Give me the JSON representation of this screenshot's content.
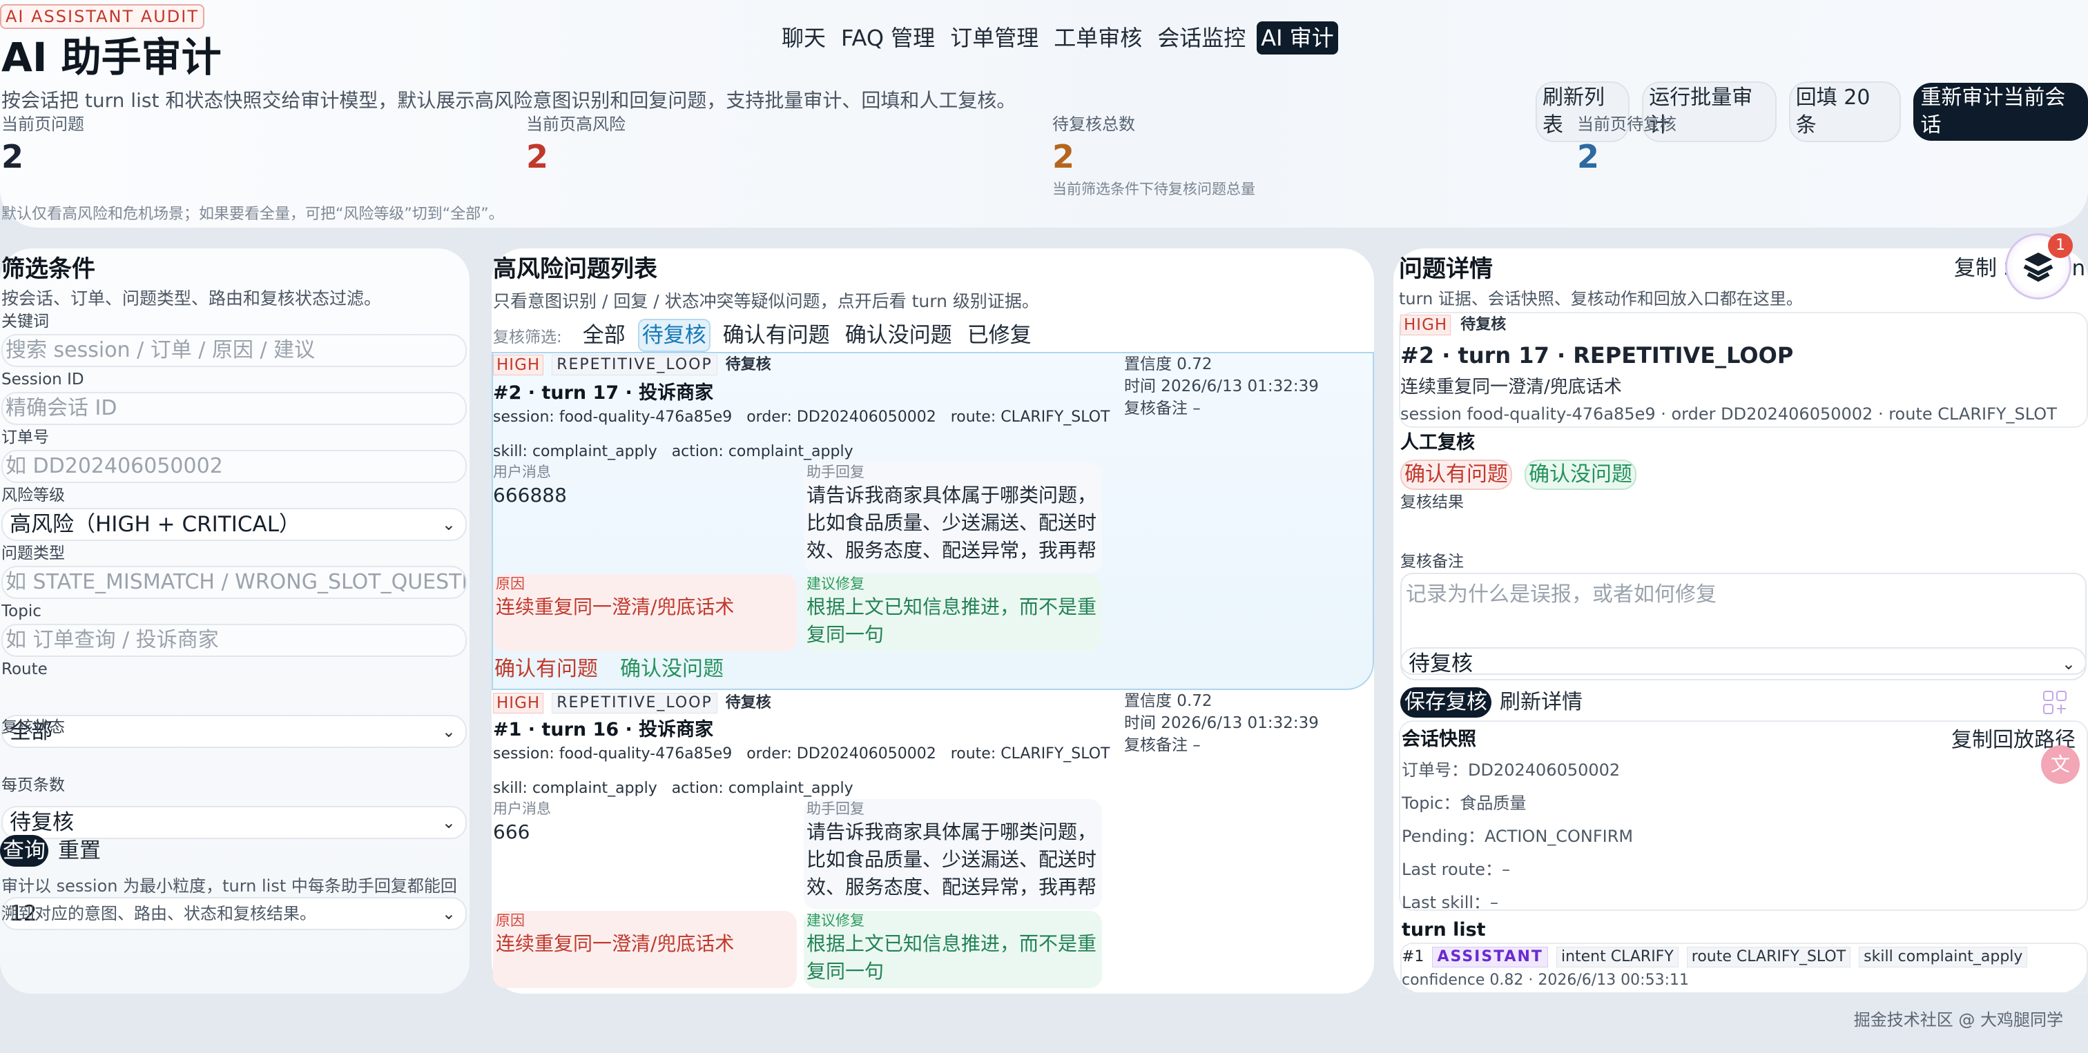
{
  "header": {
    "kicker": "AI ASSISTANT AUDIT",
    "title": "AI 助手审计",
    "subtitle": "按会话把 turn list 和状态快照交给审计模型，默认展示高风险意图识别和回复问题，支持批量审计、回填和人工复核。",
    "note": "默认仅看高风险和危机场景；如果要看全量，可把“风险等级”切到“全部”。"
  },
  "nav": [
    "聊天",
    "FAQ 管理",
    "订单管理",
    "工单审核",
    "会话监控",
    "AI 审计"
  ],
  "nav_active": "AI 审计",
  "actions": {
    "refresh": "刷新列表",
    "batch": "运行批量审计",
    "backfill": "回填 20 条",
    "reaudit": "重新审计当前会话"
  },
  "stats": [
    {
      "label": "当前页问题",
      "value": "2",
      "color": "#1b2430",
      "note": ""
    },
    {
      "label": "当前页高风险",
      "value": "2",
      "color": "#c0392b",
      "note": ""
    },
    {
      "label": "待复核总数",
      "value": "2",
      "color": "#b5651d",
      "note": "当前筛选条件下待复核问题总量"
    },
    {
      "label": "当前页待复核",
      "value": "2",
      "color": "#2d6a9f",
      "note": ""
    }
  ],
  "filter": {
    "title": "筛选条件",
    "desc": "按会话、订单、问题类型、路由和复核状态过滤。",
    "keyword_label": "关键词",
    "keyword_placeholder": "搜索 session / 订单 / 原因 / 建议",
    "session_label": "Session ID",
    "session_placeholder": "精确会话 ID",
    "order_label": "订单号",
    "order_placeholder": "如 DD202406050002",
    "risk_label": "风险等级",
    "risk_value": "高风险（HIGH + CRITICAL）",
    "type_label": "问题类型",
    "type_placeholder": "如 STATE_MISMATCH / WRONG_SLOT_QUESTION",
    "topic_label": "Topic",
    "topic_placeholder": "如 订单查询 / 投诉商家",
    "route_label": "Route",
    "route_value": "全部",
    "review_label": "复核状态",
    "review_value": "待复核",
    "pagesize_label": "每页条数",
    "pagesize_value": "12",
    "query": "查询",
    "reset": "重置",
    "note": "审计以 session 为最小粒度，turn list 中每条助手回复都能回溯到对应的意图、路由、状态和复核结果。"
  },
  "list": {
    "title": "高风险问题列表",
    "desc": "只看意图识别 / 回复 / 状态冲突等疑似问题，点开后看 turn 级别证据。",
    "review_filter_label": "复核筛选:",
    "tabs": [
      "全部",
      "待复核",
      "确认有问题",
      "确认没问题",
      "已修复"
    ],
    "active_tab": "待复核",
    "issues": [
      {
        "severity": "HIGH",
        "type": "REPETITIVE_LOOP",
        "status": "待复核",
        "title": "#2 · turn 17 · 投诉商家",
        "meta": "session: food-quality-476a85e9   order: DD202406050002   route: CLARIFY_SLOT",
        "meta2": "skill: complaint_apply   action: complaint_apply",
        "confidence": "置信度 0.72",
        "time": "时间 2026/6/13 01:32:39",
        "note": "复核备注 –",
        "user_label": "用户消息",
        "user_msg": "666888",
        "bot_label": "助手回复",
        "bot_msg": "请告诉我商家具体属于哪类问题，比如食品质量、少送漏送、配送时效、服务态度、配送异常，我再帮",
        "reason_label": "原因",
        "reason": "连续重复同一澄清/兜底话术",
        "fix_label": "建议修复",
        "fix": "根据上文已知信息推进，而不是重复同一句",
        "confirm": "确认有问题",
        "deny": "确认没问题"
      },
      {
        "severity": "HIGH",
        "type": "REPETITIVE_LOOP",
        "status": "待复核",
        "title": "#1 · turn 16 · 投诉商家",
        "meta": "session: food-quality-476a85e9   order: DD202406050002   route: CLARIFY_SLOT",
        "meta2": "skill: complaint_apply   action: complaint_apply",
        "confidence": "置信度 0.72",
        "time": "时间 2026/6/13 01:32:39",
        "note": "复核备注 –",
        "user_label": "用户消息",
        "user_msg": "666",
        "bot_label": "助手回复",
        "bot_msg": "请告诉我商家具体属于哪类问题，比如食品质量、少送漏送、配送时效、服务态度、配送异常，我再帮",
        "reason_label": "原因",
        "reason": "连续重复同一澄清/兜底话术",
        "fix_label": "建议修复",
        "fix": "根据上文已知信息推进，而不是重复同一句"
      }
    ]
  },
  "detail": {
    "title": "问题详情",
    "copy": "复制 Session",
    "desc": "turn 证据、会话快照、复核动作和回放入口都在这里。",
    "severity": "HIGH",
    "status": "待复核",
    "heading": "#2 · turn 17 · REPETITIVE_LOOP",
    "reason": "连续重复同一澄清/兜底话术",
    "meta": "session food-quality-476a85e9 · order DD202406050002 · route CLARIFY_SLOT",
    "manual_title": "人工复核",
    "confirm": "确认有问题",
    "deny": "确认没问题",
    "result_label": "复核结果",
    "result_value": "待复核",
    "note_label": "复核备注",
    "note_placeholder": "记录为什么是误报，或者如何修复",
    "save": "保存复核",
    "refresh": "刷新详情",
    "snapshot_title": "会话快照",
    "copy_replay": "复制回放路径",
    "snapshot": [
      "订单号：DD202406050002",
      "Topic：食品质量",
      "Pending：ACTION_CONFIRM",
      "Last route：–",
      "Last skill：–"
    ],
    "turnlist_title": "turn list",
    "turn_index": "#1",
    "turn_role": "ASSISTANT",
    "turn_tags": [
      "intent CLARIFY",
      "route CLARIFY_SLOT",
      "skill complaint_apply"
    ],
    "turn_sub": "confidence 0.82 · 2026/6/13 00:53:11",
    "badge_count": "1"
  },
  "watermark": "掘金技术社区 @ 大鸡腿同学"
}
